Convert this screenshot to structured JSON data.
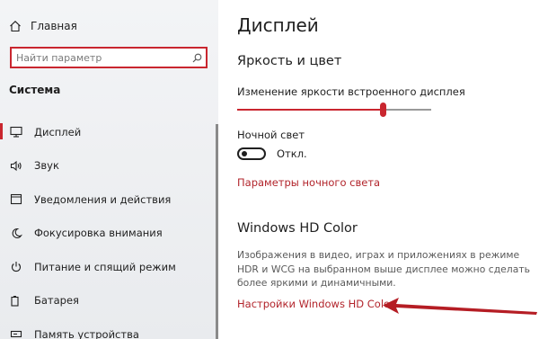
{
  "sidebar": {
    "home_label": "Главная",
    "search_placeholder": "Найти параметр",
    "section_title": "Система",
    "items": [
      {
        "label": "Дисплей",
        "icon": "monitor-icon"
      },
      {
        "label": "Звук",
        "icon": "speaker-icon"
      },
      {
        "label": "Уведомления и действия",
        "icon": "notification-icon"
      },
      {
        "label": "Фокусировка внимания",
        "icon": "moon-icon"
      },
      {
        "label": "Питание и спящий режим",
        "icon": "power-icon"
      },
      {
        "label": "Батарея",
        "icon": "battery-icon"
      },
      {
        "label": "Память устройства",
        "icon": "storage-icon"
      }
    ]
  },
  "main": {
    "title": "Дисплей",
    "brightness_heading": "Яркость и цвет",
    "brightness_label": "Изменение яркости встроенного дисплея",
    "brightness_level": 0.75,
    "night_light_label": "Ночной свет",
    "night_light_state": "Откл.",
    "night_light_settings_link": "Параметры ночного света",
    "hdr_heading": "Windows HD Color",
    "hdr_description": "Изображения в видео, играх и приложениях в режиме HDR и WCG на выбранном выше дисплее можно сделать более яркими и динамичными.",
    "hdr_settings_link": "Настройки Windows HD Color"
  },
  "colors": {
    "accent": "#c9262f",
    "link": "#b2242b",
    "annotation_arrow": "#b51d24"
  }
}
